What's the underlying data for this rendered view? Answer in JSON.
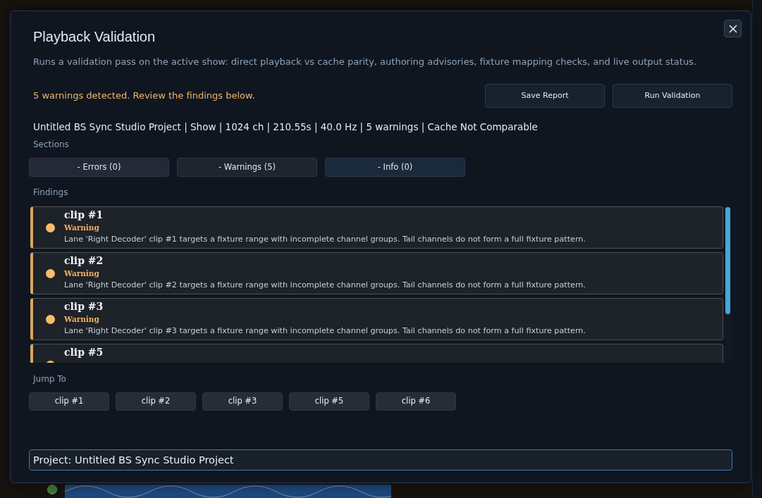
{
  "dialog": {
    "title": "Playback Validation",
    "description": "Runs a validation pass on the active show: direct playback vs cache parity, authoring advisories, fixture mapping checks, and live output status.",
    "status": {
      "text": "5 warnings detected. Review the findings below.",
      "kind": "warning"
    },
    "actions": [
      "Save Report",
      "Run Validation"
    ],
    "summary": "Untitled BS Sync Studio Project | Show | 1024 ch | 210.55s | 40.0 Hz | 5 warnings | Cache Not Comparable",
    "sections_label": "Sections",
    "sections": [
      {
        "label": "- Errors (0)",
        "kind": "error"
      },
      {
        "label": "- Warnings (5)",
        "kind": "warning"
      },
      {
        "label": "- Info (0)",
        "kind": "info"
      }
    ],
    "findings_label": "Findings",
    "findings": [
      {
        "title": "clip #1",
        "kind": "warning",
        "severity": "Warning",
        "message": "Lane 'Right Decoder' clip #1 targets a fixture range with incomplete channel groups. Tail channels do not form a full fixture pattern."
      },
      {
        "title": "clip #2",
        "kind": "warning",
        "severity": "Warning",
        "message": "Lane 'Right Decoder' clip #2 targets a fixture range with incomplete channel groups. Tail channels do not form a full fixture pattern."
      },
      {
        "title": "clip #3",
        "kind": "warning",
        "severity": "Warning",
        "message": "Lane 'Right Decoder' clip #3 targets a fixture range with incomplete channel groups. Tail channels do not form a full fixture pattern."
      },
      {
        "title": "clip #5",
        "kind": "warning"
      }
    ],
    "jump_label": "Jump To",
    "jump_to": [
      "clip #1",
      "clip #2",
      "clip #3",
      "clip #5",
      "clip #6"
    ],
    "report": {
      "value": "Project: Untitled BS Sync Studio Project"
    }
  }
}
